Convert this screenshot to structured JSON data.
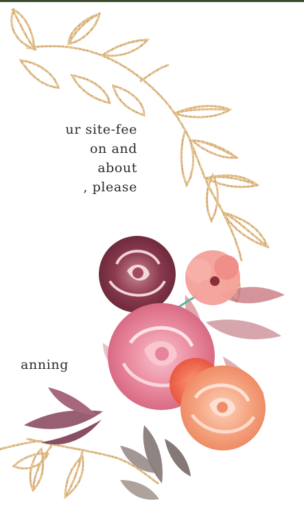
{
  "content": {
    "lines": [
      "ur site-fee",
      "on and",
      "about",
      ", please"
    ],
    "note": "anning"
  },
  "decoration": {
    "vine": "gold-glitter-leaf-vine",
    "flowers": "watercolor-rose-bouquet",
    "colors": {
      "gold": "#d9b27c",
      "burgundy": "#8a3a4e",
      "pink": "#e98a9e",
      "coral": "#f27a57",
      "peach": "#f6a683",
      "mauve": "#b76a7e",
      "taupe": "#7d6f6d"
    }
  }
}
